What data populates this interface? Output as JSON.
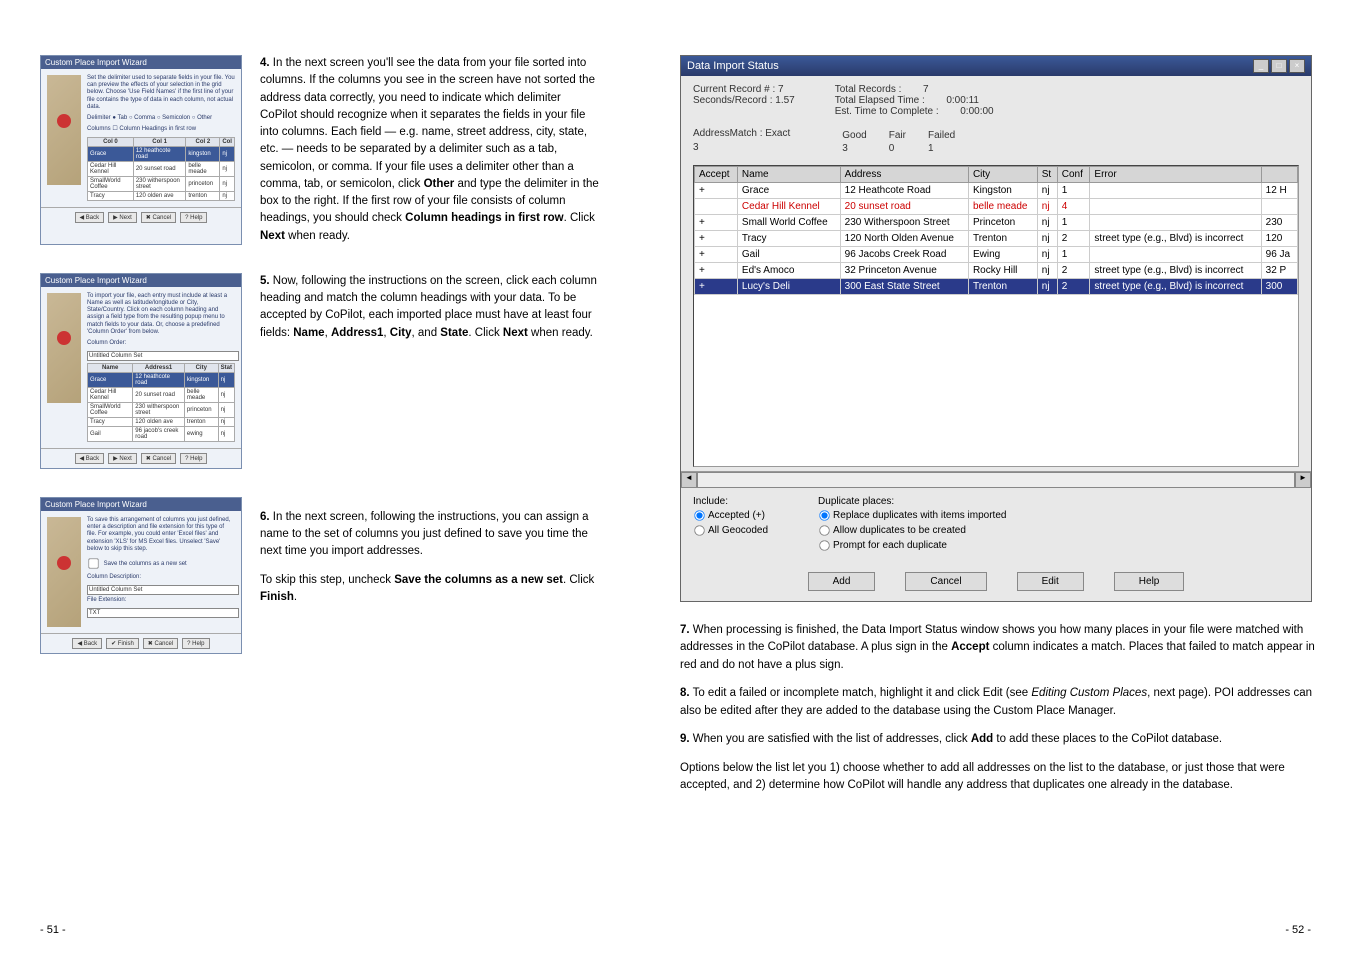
{
  "thumbs": {
    "title": "Custom Place Import Wizard",
    "btns": {
      "back": "◀ Back",
      "next": "▶ Next",
      "finish": "✔ Finish",
      "cancel": "✖ Cancel",
      "help": "? Help"
    },
    "w1": {
      "text": "Set the delimiter used to separate fields in your file. You can preview the effects of your selection in the grid below. Choose 'Use Field Names' if the first line of your file contains the type of data in each column, not actual data.",
      "delims": "Delimiter  ● Tab   ○ Comma   ○ Semicolon   ○ Other",
      "cols": "Columns  ☐ Column Headings in first row",
      "headers": [
        "Col 0",
        "Col 1",
        "Col 2",
        "Col"
      ],
      "rows": [
        [
          "Grace",
          "12 heathcote road",
          "kingston",
          "nj"
        ],
        [
          "Cedar Hill Kennel",
          "20 sunset road",
          "belle meade",
          "nj"
        ],
        [
          "SmallWorld Coffee",
          "230 witherspoon street",
          "princeton",
          "nj"
        ],
        [
          "Tracy",
          "120 olden ave",
          "trenton",
          "nj"
        ]
      ]
    },
    "w2": {
      "text": "To import your file, each entry must include at least a Name as well as latitude/longitude or City, State/Country. Click on each column heading and assign a field type from the resulting popup menu to match fields to your data. Or, choose a predefined 'Column Order' from below.",
      "label1": "Column Order:",
      "val1": "Untitled Column Set",
      "headers": [
        "Name",
        "Address1",
        "City",
        "Stat"
      ],
      "rows": [
        [
          "Grace",
          "12 heathcote road",
          "kingston",
          "nj"
        ],
        [
          "Cedar Hill Kennel",
          "20 sunset road",
          "belle meade",
          "nj"
        ],
        [
          "SmallWorld Coffee",
          "230 witherspoon street",
          "princeton",
          "nj"
        ],
        [
          "Tracy",
          "120 olden ave",
          "trenton",
          "nj"
        ],
        [
          "Gail",
          "96 jacob's creek road",
          "ewing",
          "nj"
        ]
      ]
    },
    "w3": {
      "text": "To save this arrangement of columns you just defined, enter a description and file extension for this type of file. For example, you could enter 'Excel files' and extension 'XLS' for MS Excel files. Unselect 'Save' below to skip this step.",
      "chk": "Save the columns as a new set",
      "lbl1": "Column Description:",
      "val1": "Untitled Column Set",
      "lbl2": "File Extension:",
      "val2": "TXT"
    }
  },
  "body": {
    "s4": "<b>4.</b> In the next screen you'll see the data from your file sorted into columns. If the columns you see in the screen have not sorted the address data correctly, you need to indicate which delimiter CoPilot should recognize when it separates the fields in your file into columns. Each field — e.g. name, street address, city, state, etc. — needs to be separated by a delimiter such as a tab, semicolon, or comma. If your file uses a delimiter other than a comma, tab, or semicolon, click <b>Other</b> and type the delimiter in the box to the right. If the first row of your file consists of column headings, you should check <b>Column headings in first row</b>. Click <b>Next</b> when ready.",
    "s5": "<b>5.</b> Now, following the instructions on the screen, click each column heading and match the column headings with your data. To be accepted by CoPilot, each imported place must have at least four fields: <b>Name</b>, <b>Address1</b>, <b>City</b>, and <b>State</b>. Click <b>Next</b> when ready.",
    "s6a": "<b>6.</b> In the next screen, following the instructions, you can assign a name to the set of columns you just defined to save you time the next time you import addresses.",
    "s6b": "To skip this step, uncheck <b>Save the columns as a new set</b>. Click <b>Finish</b>.",
    "s7": "<b>7.</b> When processing is finished, the Data Import Status window shows you how many places in your file were matched with addresses in the CoPilot database. A plus sign in the <b>Accept</b> column indicates a match. Places that failed to match appear in red and do not have a plus sign.",
    "s8": "<b>8.</b> To edit a failed or incomplete match, highlight it and click Edit (see <i>Editing Custom Places</i>, next page). POI addresses can also be edited after they are added to the database using the Custom Place Manager.",
    "s9": "<b>9.</b> When you are satisfied with the list of addresses, click <b>Add</b> to add these places to the CoPilot database.",
    "s10": "Options below the list let you 1) choose whether to add all addresses on the list to the database, or just those that were accepted, and 2) determine how CoPilot will handle any address that duplicates one already in the database."
  },
  "dis": {
    "title": "Data Import Status",
    "top": {
      "l1": "Current Record # : 7",
      "l2": "Seconds/Record : 1.57",
      "m1": "Total Records :",
      "m1v": "7",
      "m2": "Total Elapsed Time :",
      "m2v": "0:00:11",
      "m3": "Est. Time to Complete :",
      "m3v": "0:00:00",
      "am": "AddressMatch : Exact",
      "g": "Good",
      "f": "Fair",
      "fl": "Failed",
      "ex": "3",
      "gd": "3",
      "fr": "0",
      "fd": "1"
    },
    "headers": [
      "Accept",
      "Name",
      "Address",
      "City",
      "St",
      "Conf",
      "Error",
      ""
    ],
    "rows": [
      {
        "a": "+",
        "n": "Grace",
        "ad": "12 Heathcote Road",
        "c": "Kingston",
        "s": "nj",
        "cf": "1",
        "e": "",
        "r": "12 H"
      },
      {
        "a": "",
        "n": "Cedar Hill Kennel",
        "ad": "20 sunset road",
        "c": "belle meade",
        "s": "nj",
        "cf": "4",
        "e": "",
        "r": "",
        "cls": "red"
      },
      {
        "a": "+",
        "n": "Small World Coffee",
        "ad": "230 Witherspoon Street",
        "c": "Princeton",
        "s": "nj",
        "cf": "1",
        "e": "",
        "r": "230"
      },
      {
        "a": "+",
        "n": "Tracy",
        "ad": "120 North Olden Avenue",
        "c": "Trenton",
        "s": "nj",
        "cf": "2",
        "e": "street type (e.g., Blvd) is incorrect",
        "r": "120"
      },
      {
        "a": "+",
        "n": "Gail",
        "ad": "96 Jacobs Creek Road",
        "c": "Ewing",
        "s": "nj",
        "cf": "1",
        "e": "",
        "r": "96 Ja"
      },
      {
        "a": "+",
        "n": "Ed's Amoco",
        "ad": "32 Princeton Avenue",
        "c": "Rocky Hill",
        "s": "nj",
        "cf": "2",
        "e": "street type (e.g., Blvd) is incorrect",
        "r": "32 P"
      },
      {
        "a": "+",
        "n": "Lucy's Deli",
        "ad": "300 East State Street",
        "c": "Trenton",
        "s": "nj",
        "cf": "2",
        "e": "street type (e.g., Blvd) is incorrect",
        "r": "300",
        "cls": "sel"
      }
    ],
    "inc": {
      "lbl": "Include:",
      "a": "Accepted (+)",
      "b": "All Geocoded"
    },
    "dup": {
      "lbl": "Duplicate places:",
      "a": "Replace duplicates with items imported",
      "b": "Allow duplicates to be created",
      "c": "Prompt for each duplicate"
    },
    "btns": {
      "add": "Add",
      "cancel": "Cancel",
      "edit": "Edit",
      "help": "Help"
    }
  },
  "pg": {
    "l": "- 51 -",
    "r": "- 52 -"
  }
}
